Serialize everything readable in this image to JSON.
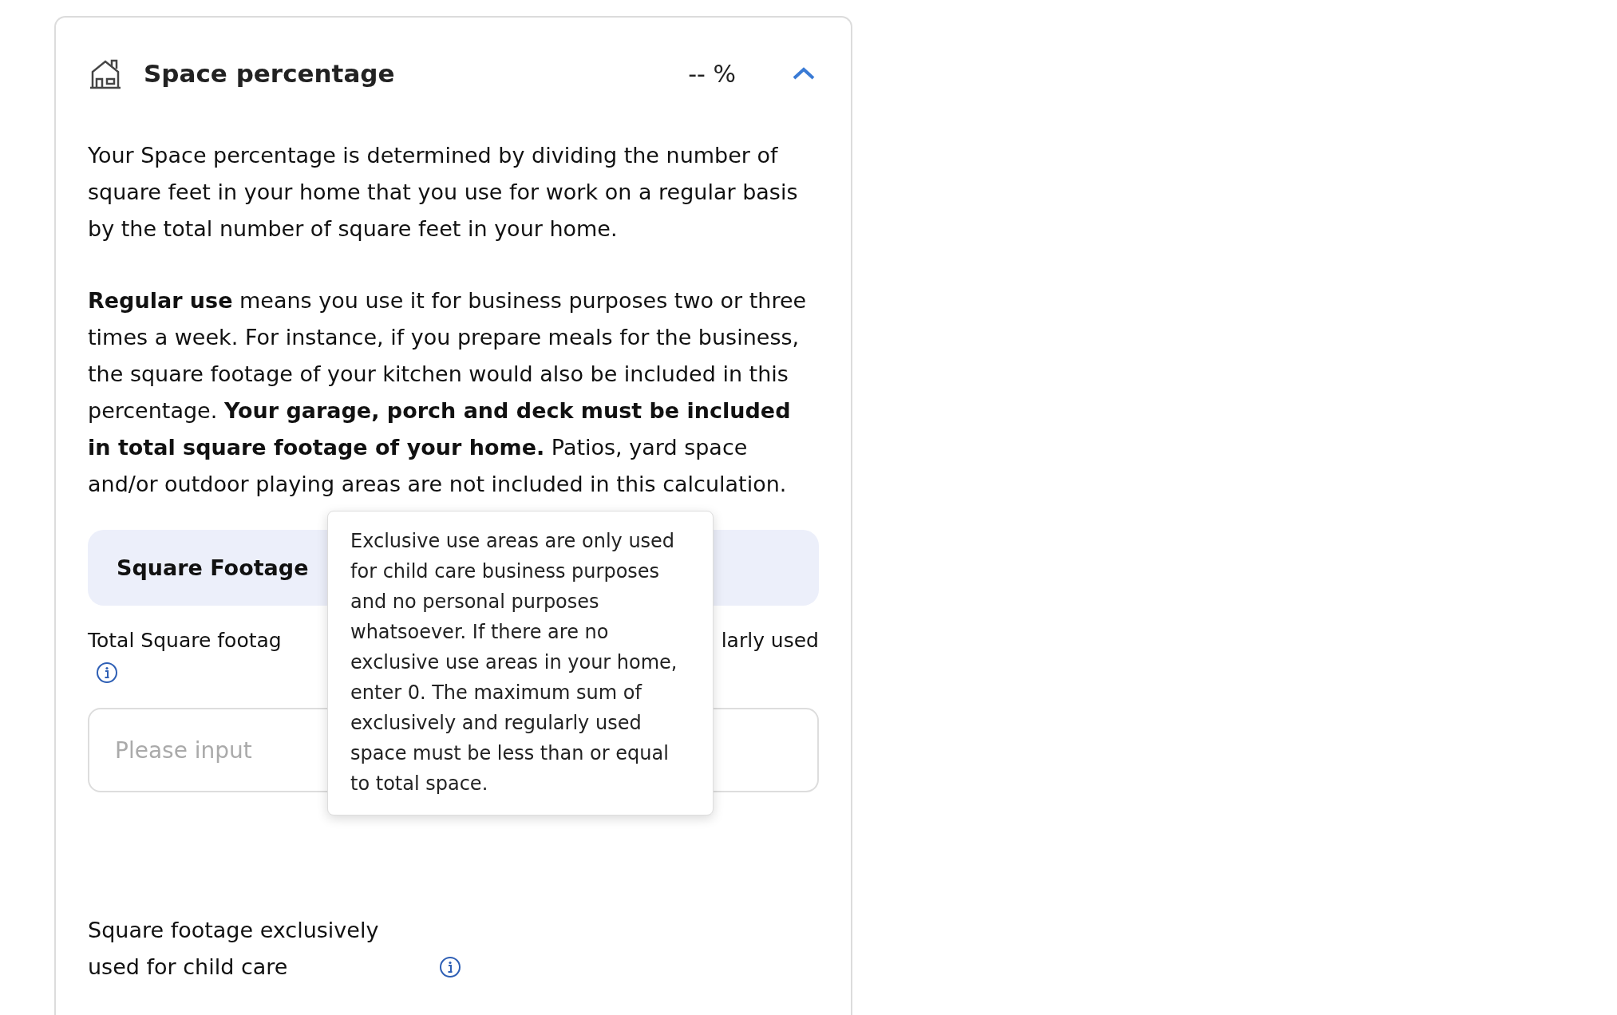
{
  "card": {
    "title": "Space percentage",
    "value": "-- %",
    "expanded": true,
    "paragraphs": [
      "Your Space percentage is determined by dividing the number of square feet in your home that you use for work on a regular basis by the total number of square feet in your home.",
      "**Regular use** means you use it for business purposes two or three times a week. For instance, if you prepare meals for the business, the square footage of your kitchen would also be included in this percentage. **Your garage, porch and deck must be included in total square footage of your home.** Patios, yard space and/or outdoor playing areas are not included in this calculation."
    ],
    "section_title": "Square Footage",
    "fields": [
      {
        "label_left": "Total Square footag",
        "label_right": "larly used",
        "placeholder": "Please input"
      }
    ],
    "second_label": "Square footage exclusively used for child care",
    "tooltip": "Exclusive use areas are only used for child care business purposes and no personal purposes whatsoever. If there are no exclusive use areas in your home, enter 0. The maximum sum of exclusively and regularly used space must be less than or equal to total space."
  }
}
